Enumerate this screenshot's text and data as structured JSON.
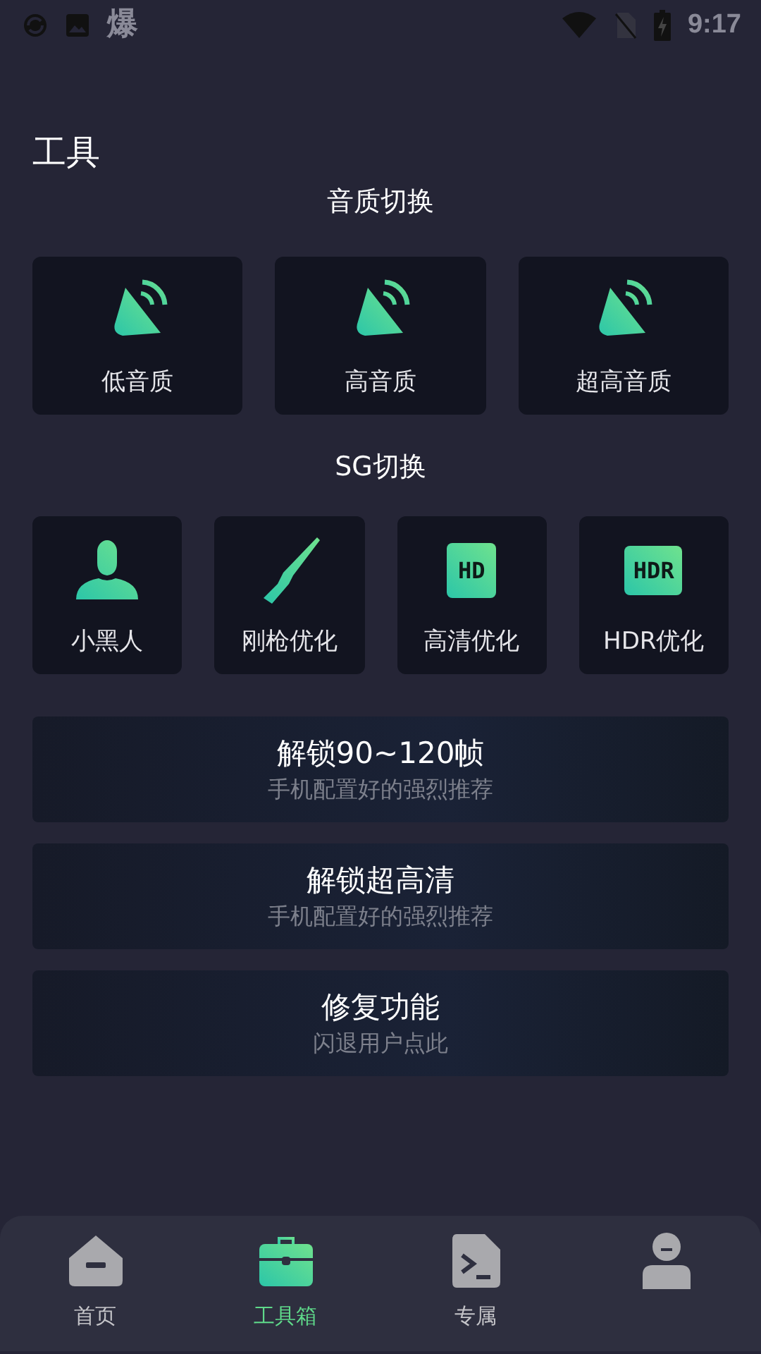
{
  "status_bar": {
    "notification_text": "爆",
    "time": "9:17"
  },
  "page_title": "工具",
  "sections": [
    {
      "title": "音质切换",
      "kind": "quality",
      "items": [
        {
          "label": "低音质"
        },
        {
          "label": "高音质"
        },
        {
          "label": "超高音质"
        }
      ]
    },
    {
      "title": "SG切换",
      "kind": "sg",
      "items": [
        {
          "label": "小黑人"
        },
        {
          "label": "刚枪优化"
        },
        {
          "label": "高清优化"
        },
        {
          "label": "HDR优化"
        }
      ]
    }
  ],
  "hd_badge": "HD",
  "hdr_badge": "HDR",
  "actions": [
    {
      "title": "解锁90~120帧",
      "subtitle": "手机配置好的强烈推荐"
    },
    {
      "title": "解锁超高清",
      "subtitle": "手机配置好的强烈推荐"
    },
    {
      "title": "修复功能",
      "subtitle": "闪退用户点此"
    }
  ],
  "tabs": [
    {
      "label": "首页",
      "selected": false
    },
    {
      "label": "工具箱",
      "selected": true
    },
    {
      "label": "专属",
      "selected": false
    },
    {
      "selected": false
    }
  ]
}
